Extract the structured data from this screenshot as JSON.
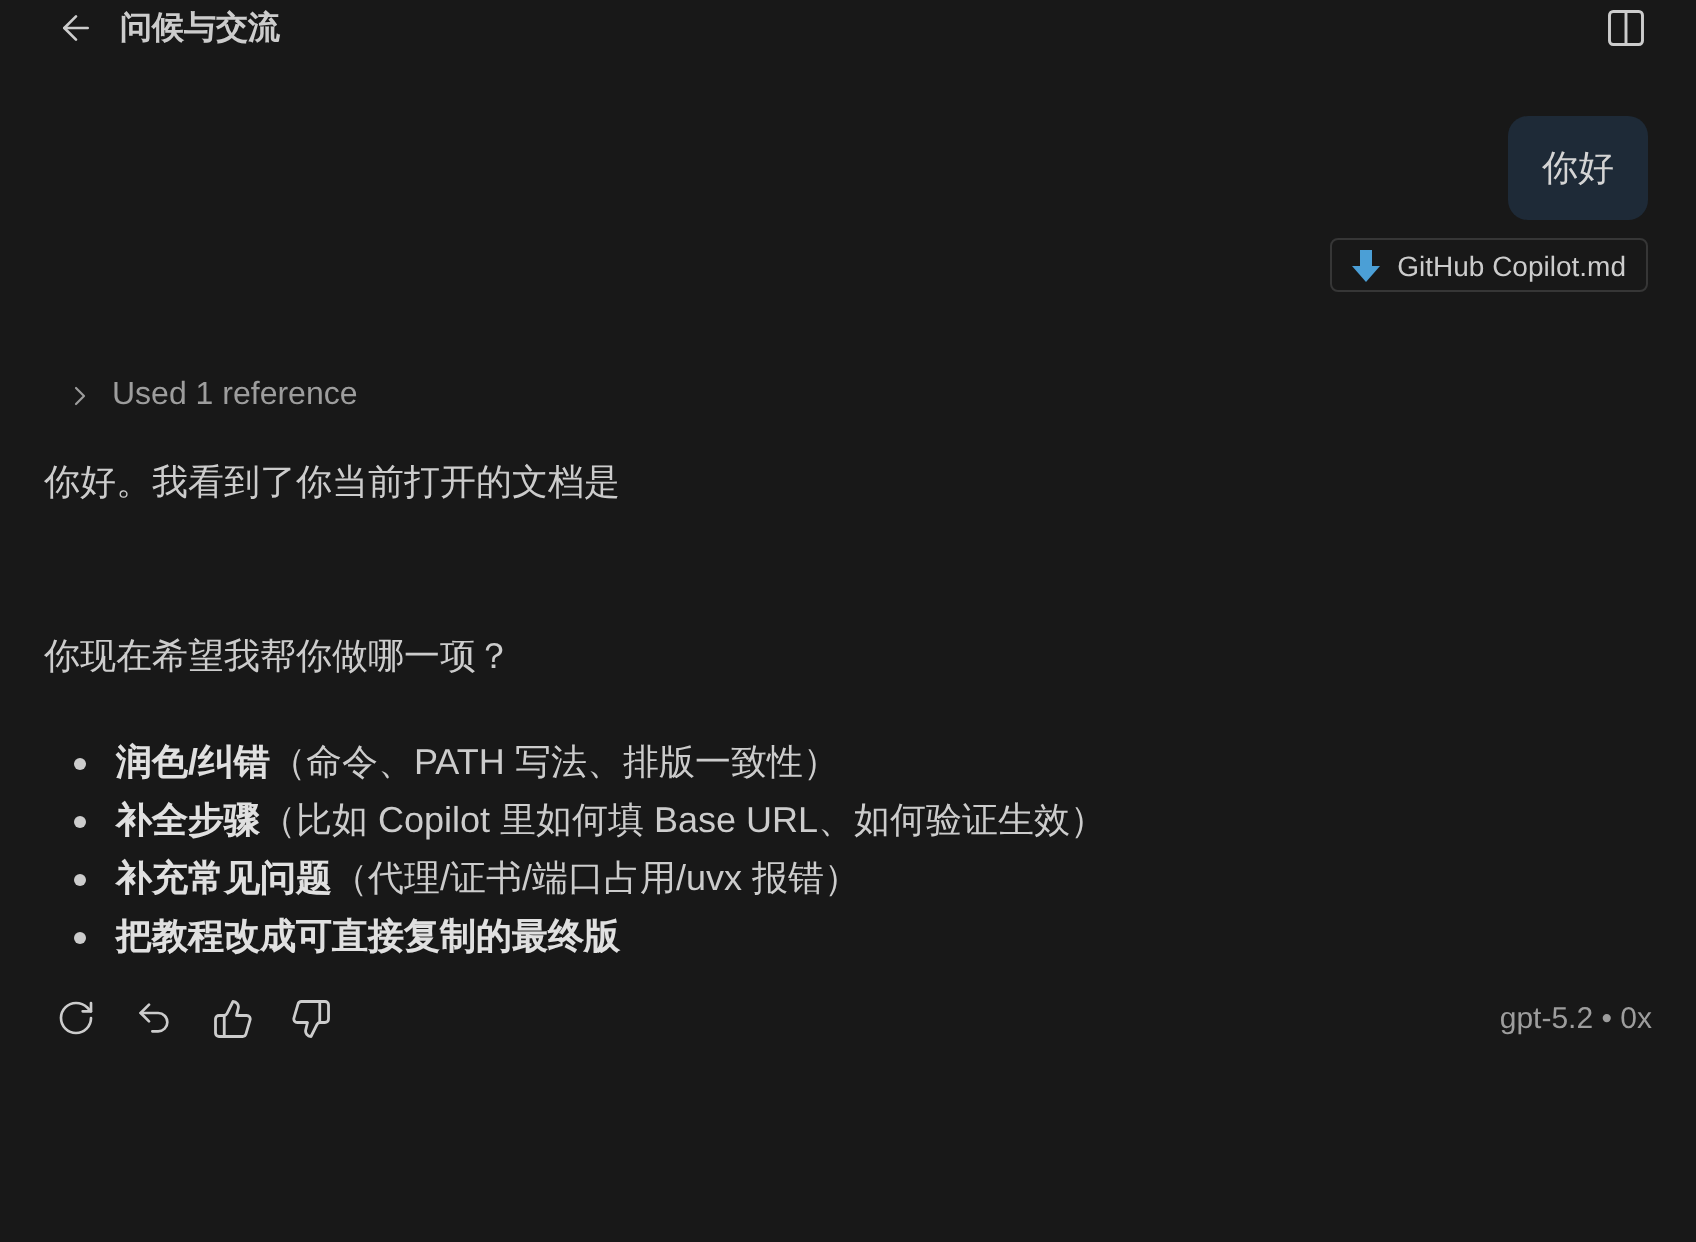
{
  "header": {
    "title": "问候与交流"
  },
  "user_message": {
    "text": "你好",
    "attachments": [
      {
        "name": "GitHub Copilot.md"
      }
    ]
  },
  "response": {
    "references": {
      "label": "Used 1 reference",
      "expanded": false
    },
    "paragraphs": [
      "你好。我看到了你当前打开的文档是",
      "你现在希望我帮你做哪一项？"
    ],
    "options": [
      {
        "title": "润色/纠错",
        "detail": "（命令、PATH 写法、排版一致性）"
      },
      {
        "title": "补全步骤",
        "detail": "（比如 Copilot 里如何填 Base URL、如何验证生效）"
      },
      {
        "title": "补充常见问题",
        "detail": "（代理/证书/端口占用/uvx 报错）"
      },
      {
        "title": "把教程改成可直接复制的最终版"
      }
    ],
    "model_info": "gpt-5.2 • 0x"
  }
}
